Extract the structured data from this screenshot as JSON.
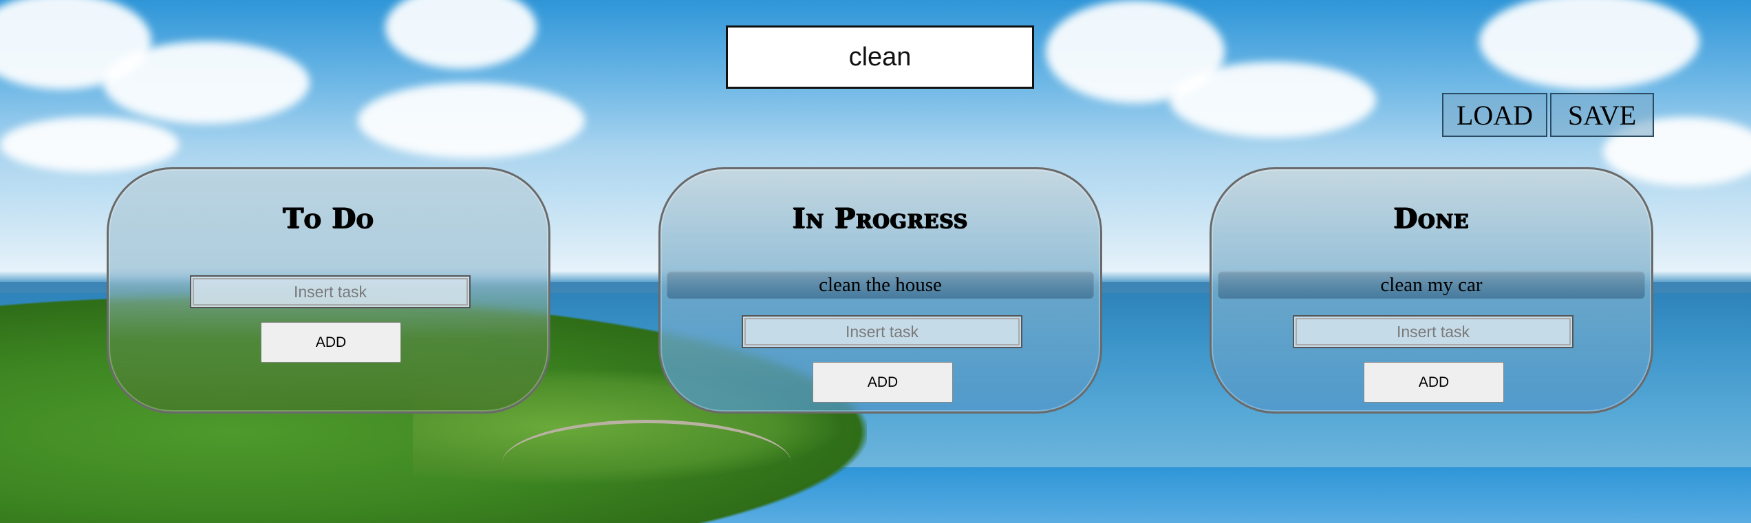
{
  "search": {
    "value": "clean"
  },
  "toolbar": {
    "load_label": "LOAD",
    "save_label": "SAVE"
  },
  "columns": [
    {
      "title": "To Do",
      "tasks": [],
      "input_placeholder": "Insert task",
      "add_label": "ADD"
    },
    {
      "title": "In Progress",
      "tasks": [
        "clean the house"
      ],
      "input_placeholder": "Insert task",
      "add_label": "ADD"
    },
    {
      "title": "Done",
      "tasks": [
        "clean my car"
      ],
      "input_placeholder": "Insert task",
      "add_label": "ADD"
    }
  ]
}
